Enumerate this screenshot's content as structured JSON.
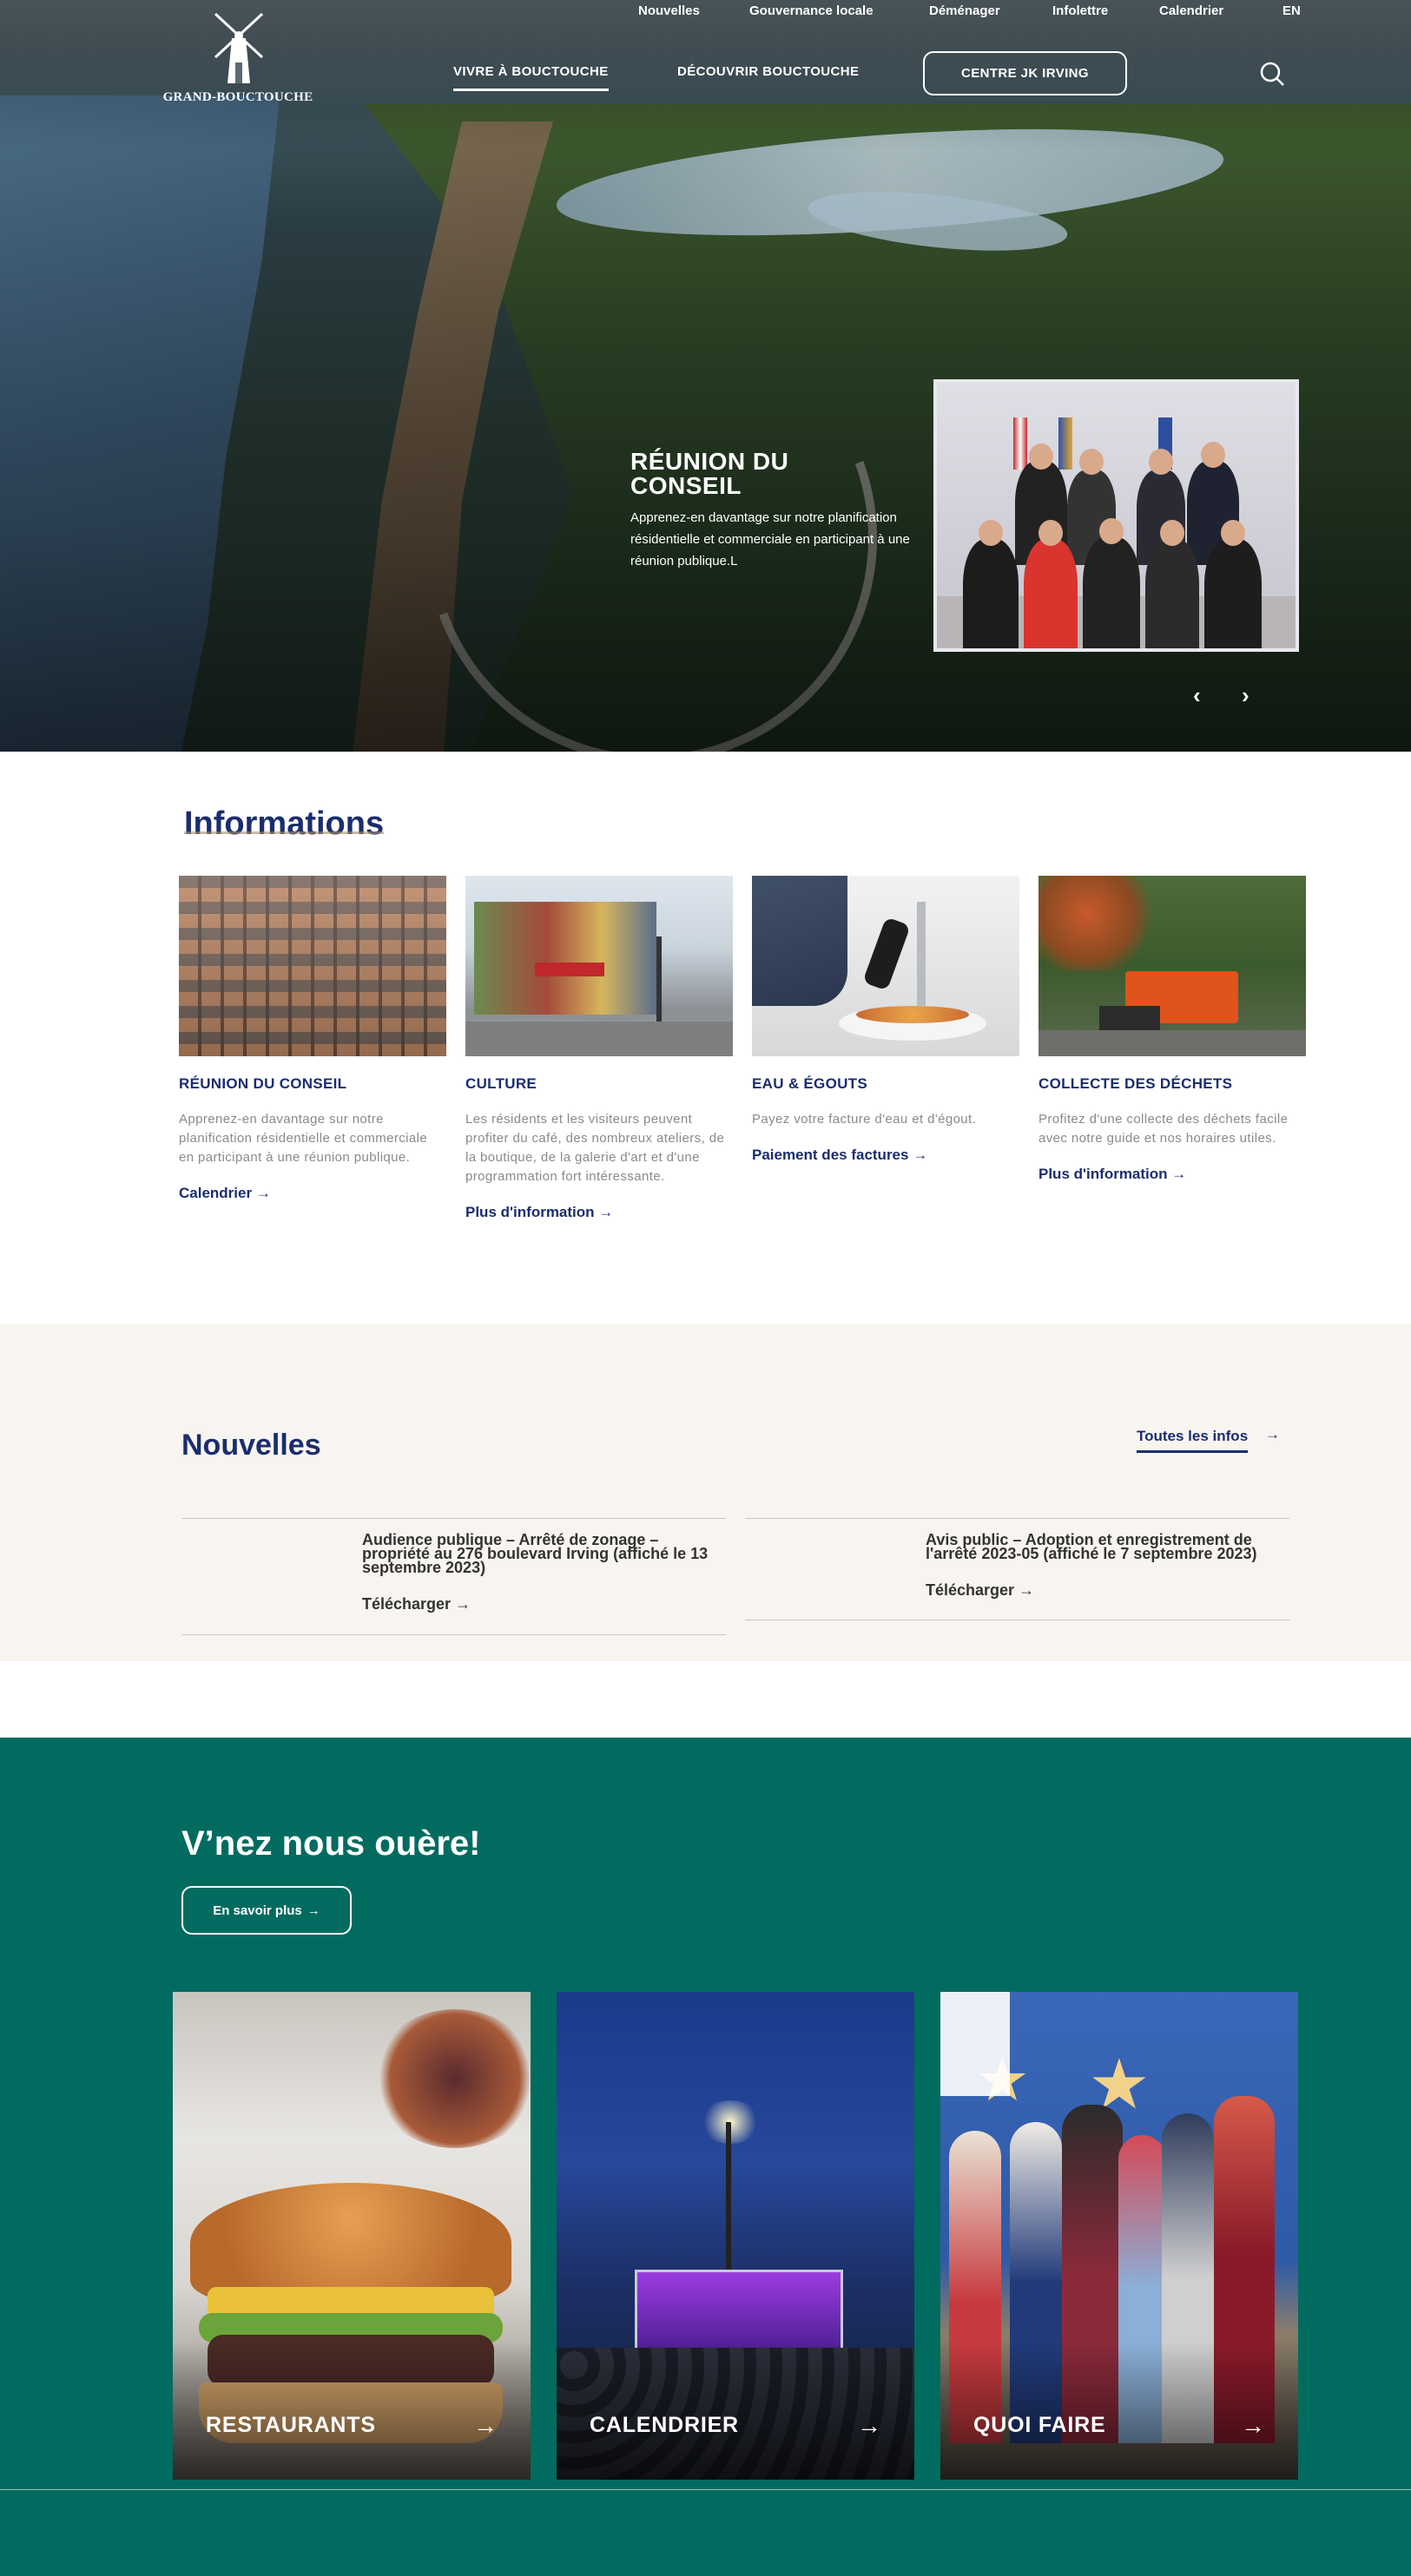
{
  "brand": {
    "logo_text": "GRAND-BOUCTOUCHE"
  },
  "topnav": [
    "Nouvelles",
    "Gouvernance locale",
    "Déménager",
    "Infolettre",
    "Calendrier",
    "EN"
  ],
  "mainnav": {
    "item1": "VIVRE À BOUCTOUCHE",
    "item2": "DÉCOUVRIR BOUCTOUCHE",
    "cta": "CENTRE JK IRVING"
  },
  "hero": {
    "title_line1": "RÉUNION DU",
    "title_line2": "CONSEIL",
    "text": "Apprenez-en davantage sur notre planification résidentielle et commerciale en participant à une réunion publique.L",
    "prev": "‹",
    "next": "›"
  },
  "info": {
    "title": "Informations",
    "cards": [
      {
        "title": "RÉUNION DU CONSEIL",
        "text": "Apprenez-en davantage sur notre planification résidentielle et commerciale en participant à une réunion publique.",
        "link": "Calendrier"
      },
      {
        "title": "CULTURE",
        "text": "Les résidents et les visiteurs peuvent profiter du café, des nombreux ateliers, de la boutique, de la galerie d'art et d'une programmation fort intéressante.",
        "link": "Plus d'information"
      },
      {
        "title": "EAU & ÉGOUTS",
        "text": "Payez votre facture d'eau et d'égout.",
        "link": "Paiement des factures"
      },
      {
        "title": "COLLECTE DES DÉCHETS",
        "text": "Profitez d'une collecte des déchets facile avec notre guide et nos horaires utiles.",
        "link": "Plus d'information"
      }
    ]
  },
  "news": {
    "title": "Nouvelles",
    "all_link": "Toutes les infos",
    "items": [
      {
        "title": "Audience publique – Arrêté de zonage – propriété au 276 boulevard Irving (affiché le 13 septembre 2023)",
        "download": "Télécharger"
      },
      {
        "title": "Avis public – Adoption et enregistrement de l'arrêté 2023-05 (affiché le 7 septembre 2023)",
        "download": "Télécharger"
      }
    ]
  },
  "venez": {
    "title": "V’nez nous ouère!",
    "button": "En savoir plus",
    "tiles": [
      "RESTAURANTS",
      "CALENDRIER",
      "QUOI FAIRE"
    ]
  },
  "icons": {
    "arrow": "→",
    "search": "search-icon",
    "logo": "windmill-logo"
  },
  "colors": {
    "navy": "#1b2d6e",
    "teal": "#026b5f",
    "cream": "#f8f5f0"
  }
}
